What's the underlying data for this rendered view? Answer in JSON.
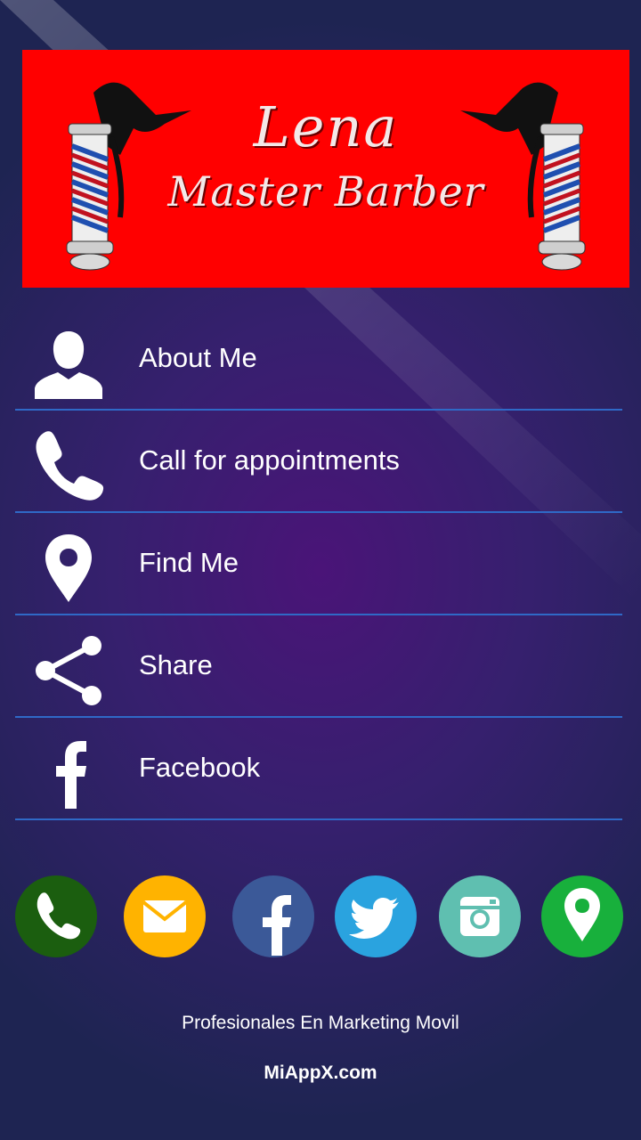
{
  "banner": {
    "line1": "Lena",
    "line2": "Master Barber",
    "background": "#ff0000"
  },
  "menu": {
    "items": [
      {
        "label": "About Me",
        "icon": "person-icon"
      },
      {
        "label": "Call for appointments",
        "icon": "phone-icon"
      },
      {
        "label": "Find Me",
        "icon": "map-pin-icon"
      },
      {
        "label": "Share",
        "icon": "share-icon"
      },
      {
        "label": "Facebook",
        "icon": "facebook-icon"
      }
    ],
    "divider_color": "#2f69c7"
  },
  "social": [
    {
      "icon": "phone-icon",
      "color": "#1b5e0f"
    },
    {
      "icon": "email-icon",
      "color": "#ffb300"
    },
    {
      "icon": "facebook-icon",
      "color": "#3b5998"
    },
    {
      "icon": "twitter-icon",
      "color": "#2aa3df"
    },
    {
      "icon": "instagram-icon",
      "color": "#5fbfb0"
    },
    {
      "icon": "map-pin-icon",
      "color": "#18b03c"
    }
  ],
  "footer": {
    "tagline": "Profesionales En Marketing Movil",
    "site": "MiAppX.com"
  }
}
